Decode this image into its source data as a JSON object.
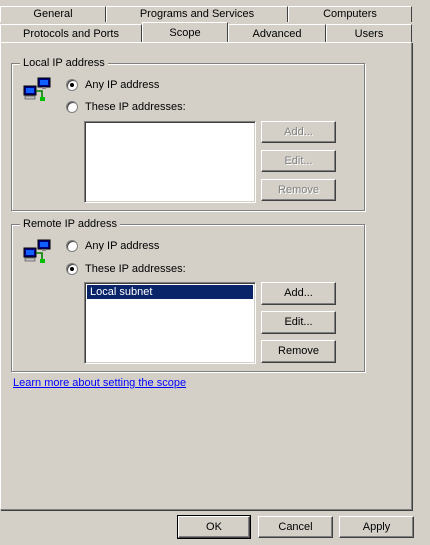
{
  "tabs_row1": [
    "General",
    "Programs and Services",
    "Computers"
  ],
  "tabs_row2": [
    "Protocols and Ports",
    "Scope",
    "Advanced",
    "Users"
  ],
  "selected_tab": "Scope",
  "local_group": {
    "legend": "Local IP address",
    "any_label": "Any IP address",
    "these_label": "These IP addresses:",
    "selected_option": "any",
    "list_items": [],
    "add_label": "Add...",
    "edit_label": "Edit...",
    "remove_label": "Remove"
  },
  "remote_group": {
    "legend": "Remote IP address",
    "any_label": "Any IP address",
    "these_label": "These IP addresses:",
    "selected_option": "these",
    "list_items": [
      "Local subnet"
    ],
    "add_label": "Add...",
    "edit_label": "Edit...",
    "remove_label": "Remove"
  },
  "learn_more_link": "Learn more about setting the scope",
  "footer": {
    "ok_label": "OK",
    "cancel_label": "Cancel",
    "apply_label": "Apply"
  },
  "icons": {
    "network_icon": "network-computers-icon"
  }
}
